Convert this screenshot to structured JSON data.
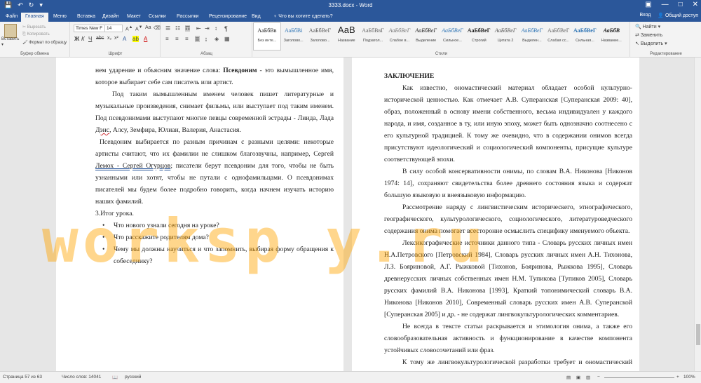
{
  "window": {
    "title": "3333.docx - Word",
    "controls": [
      "—",
      "□",
      "✕"
    ]
  },
  "ribbon_tabs": {
    "items": [
      "Файл",
      "Главная",
      "Меню",
      "Вставка",
      "Дизайн",
      "Макет",
      "Ссылки",
      "Рассылки",
      "Рецензирование",
      "Вид"
    ],
    "tell_me": "Что вы хотите сделать?",
    "signin": "Вход",
    "share": "Общий доступ"
  },
  "clipboard": {
    "paste": "Вставить",
    "cut": "Вырезать",
    "copy": "Копировать",
    "format_painter": "Формат по образцу",
    "label": "Буфер обмена"
  },
  "font": {
    "name": "Times New F",
    "size": "14",
    "label": "Шрифт"
  },
  "paragraph": {
    "label": "Абзац"
  },
  "styles": {
    "label": "Стили",
    "items": [
      {
        "sample": "АаБбВв",
        "name": "Без инте..."
      },
      {
        "sample": "АаБбВі",
        "name": "Заголово..."
      },
      {
        "sample": "АаБбВеГ",
        "name": "Заголово..."
      },
      {
        "sample": "АаВ",
        "name": "Название"
      },
      {
        "sample": "АаБбВвГ",
        "name": "Подзагол..."
      },
      {
        "sample": "АаБбВеГ",
        "name": "Слабое в..."
      },
      {
        "sample": "АаБбВеГ",
        "name": "Выделение"
      },
      {
        "sample": "АаБбВеГ",
        "name": "Сильное..."
      },
      {
        "sample": "АаБбВеГ",
        "name": "Строгий"
      },
      {
        "sample": "АаБбВеГ",
        "name": "Цитата 2"
      },
      {
        "sample": "АаБбВеГ",
        "name": "Выделен..."
      },
      {
        "sample": "АаБбВеГ",
        "name": "Слабая сс..."
      },
      {
        "sample": "АаБбВеГ",
        "name": "Сильная..."
      },
      {
        "sample": "АаБбВ",
        "name": "Название..."
      }
    ]
  },
  "editing": {
    "find": "Найти",
    "replace": "Заменить",
    "select": "Выделить",
    "label": "Редактирование"
  },
  "left_page": {
    "p1a": "нем ударение и объясним значение слова: ",
    "p1b": "Псевдоним",
    "p1c": " - это вымышленное имя, которое выбирает себе сам писатель или артист.",
    "p2": "Под таким вымышленным именем человек пишет литературные и музыкальные произведения, снимает фильмы, или выступает под таким именем. Под псевдонимами выступают многие певцы современной эстрады - Лиида, Лада",
    "p2b": "Дэнс",
    "p2c": ", Алсу, Земфира, Юлиан, Валерия, Анастасия.",
    "p3": "Псевдоним выбирается по разным причинам с разными целями: некоторые артисты считают, что их фамилии не слишком благозвучны, например, Сергей",
    "p3b": "Лемох - Сергей Огурцов",
    "p3c": "; писатели берут псевдоним для того, чтобы не быть узнанными или хотят, чтобы не путали с однофамильцами. О псевдонимах писателей мы будем более подробно говорить, когда начнем изучать историю наших фамилий.",
    "p4": "3.Итог урока.",
    "bullets": [
      "Что нового узнали сегодня на уроке?",
      "Что расскажите родителям дома?",
      "Чему мы должны научиться и что запомнить, выбирая форму обращения к собеседнику?"
    ]
  },
  "right_page": {
    "heading": "ЗАКЛЮЧЕНИЕ",
    "p1": "Как известно, ономастический материал обладает особой культурно-исторической ценностью. Как отмечает А.В. Суперанская [Суперанская 2009: 40], образ, положенный в основу имени собственного, весьма индивидуален у каждого народа, и имя, созданное в ту, или иную эпоху, может быть однозначно соотнесено с его культурной традицией. К тому же очевидно, что в содержании онимов всегда присутствуют идеологический и социологический компоненты, присущие культуре соответствующей эпохи.",
    "p2": "В силу особой консервативности онимы, по словам В.А. Никонова [Никонов 1974: 14], сохраняют свидетельства более древнего состояния языка и содержат большую языковую и внеязыковую информацию.",
    "p3": "Рассмотрение наряду с лингвистическим историческего, этнографического, географического, культурологического, социологического, литературоведческого содержания онима помогает всесторонне осмыслить специфику именуемого объекта.",
    "p4": "Лексикографические источники данного типа - Словарь русских личных имен Н.А.Петровского [Петровский 1984], Словарь русских личных имен А.Н. Тихонова, Л.З. Бояриновой, А.Г. Рыжковой [Тихонов, Бояринова, Рыжкова 1995], Словарь древнерусских личных собственных имен Н.М. Тупикова [Тупиков 2005], Словарь русских фамилий В.А. Никонова [1993], Краткий топонимический словарь В.А. Никонова [Никонов 2010], Современный словарь русских имен А.В. Суперанской [Суперанская 2005] и др. - не содержат лингвокультурологических комментариев.",
    "p5": "Не всегда в тексте статьи раскрывается и этимология онима, а также его словообразовательная активность и функционирование в качестве компонента устойчивых словосочетаний или фраз.",
    "p6": "К тому же лингвокультурологической разработки требует и ономастический материал, с которым сталкиваются иностранцы, обучающиеся в"
  },
  "watermark": "worksp y.ru",
  "statusbar": {
    "page": "Страница 57 из 63",
    "words": "Число слов: 14041",
    "lang": "русский",
    "zoom": "100%"
  }
}
